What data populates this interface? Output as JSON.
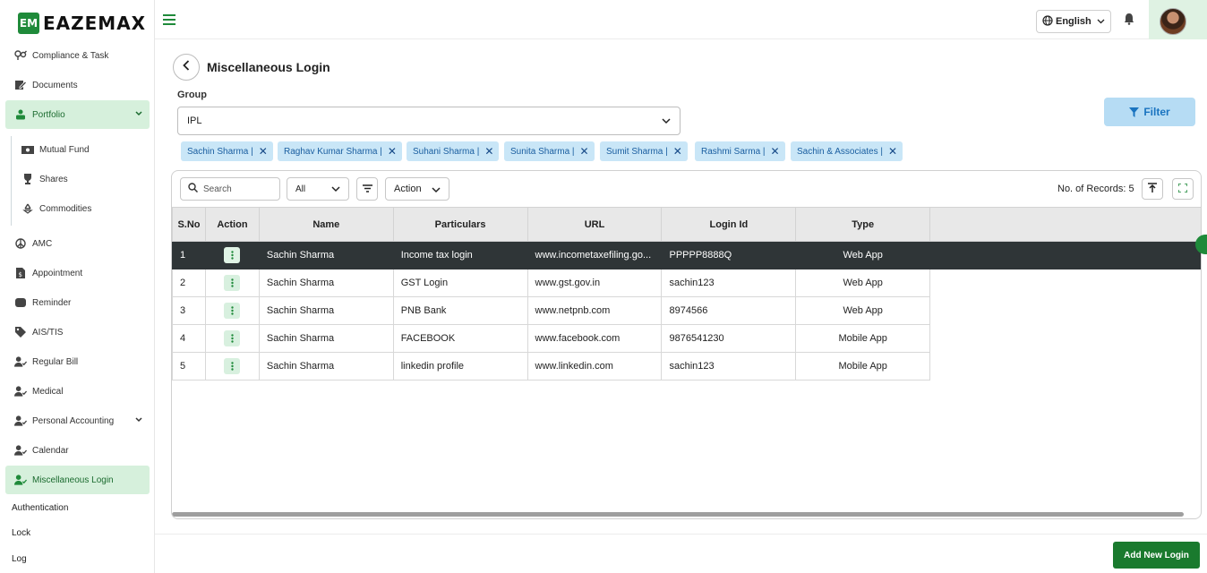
{
  "brand": {
    "mark": "EM",
    "name": "EAZEMAX"
  },
  "sidebar": {
    "items": [
      {
        "label": "Compliance & Task",
        "icon": "gender-icon"
      },
      {
        "label": "Documents",
        "icon": "document-edit-icon"
      },
      {
        "label": "Portfolio",
        "icon": "person-money-icon",
        "active": true,
        "expanded": true
      },
      {
        "label": "Mutual Fund",
        "icon": "money-icon",
        "sub": true
      },
      {
        "label": "Shares",
        "icon": "trophy-icon",
        "sub": true
      },
      {
        "label": "Commodities",
        "icon": "recycle-icon",
        "sub": true
      },
      {
        "label": "AMC",
        "icon": "peace-icon"
      },
      {
        "label": "Appointment",
        "icon": "file-dollar-icon"
      },
      {
        "label": "Reminder",
        "icon": "calendar-badge-icon"
      },
      {
        "label": "AIS/TIS",
        "icon": "tag-icon"
      },
      {
        "label": "Regular Bill",
        "icon": "user-check-icon"
      },
      {
        "label": "Medical",
        "icon": "user-check-icon"
      },
      {
        "label": "Personal Accounting",
        "icon": "user-check-icon"
      },
      {
        "label": "Calendar",
        "icon": "user-check-icon"
      },
      {
        "label": "Miscellaneous Login",
        "icon": "user-check-icon",
        "active": true
      }
    ],
    "plain": [
      "Authentication",
      "Lock",
      "Log"
    ]
  },
  "header": {
    "language": "English"
  },
  "page": {
    "title": "Miscellaneous Login",
    "group_label": "Group",
    "group_value": "IPL",
    "filter_label": "Filter",
    "chips": [
      "Sachin Sharma |",
      "Raghav Kumar Sharma |",
      "Suhani Sharma |",
      "Sunita Sharma |",
      "Sumit Sharma |",
      "Rashmi Sarma |",
      "Sachin & Associates |"
    ],
    "chip_close": "✕"
  },
  "table_tools": {
    "search_placeholder": "Search",
    "all_option": "All",
    "action_option": "Action",
    "records_label": "No. of Records: 5"
  },
  "table": {
    "headers": [
      "S.No",
      "Action",
      "Name",
      "Particulars",
      "URL",
      "Login Id",
      "Type"
    ],
    "rows": [
      {
        "sno": "1",
        "name": "Sachin Sharma",
        "particulars": "Income tax login",
        "url": "www.incometaxefiling.go...",
        "login": "PPPPP8888Q",
        "type": "Web App"
      },
      {
        "sno": "2",
        "name": "Sachin Sharma",
        "particulars": "GST Login",
        "url": "www.gst.gov.in",
        "login": "sachin123",
        "type": "Web App"
      },
      {
        "sno": "3",
        "name": "Sachin Sharma",
        "particulars": "PNB Bank",
        "url": "www.netpnb.com",
        "login": "8974566",
        "type": "Web App"
      },
      {
        "sno": "4",
        "name": "Sachin Sharma",
        "particulars": "FACEBOOK",
        "url": "www.facebook.com",
        "login": "9876541230",
        "type": "Mobile App"
      },
      {
        "sno": "5",
        "name": "Sachin Sharma",
        "particulars": "linkedin profile",
        "url": "www.linkedin.com",
        "login": "sachin123",
        "type": "Mobile App"
      }
    ]
  },
  "footer": {
    "add_label": "Add New Login"
  },
  "colors": {
    "brand_green": "#1f8a3a",
    "active_bg": "#d6f0dc",
    "chip_bg": "#c9e6f7",
    "filter_bg": "#b6dcf4",
    "selected_row": "#2f3537"
  }
}
